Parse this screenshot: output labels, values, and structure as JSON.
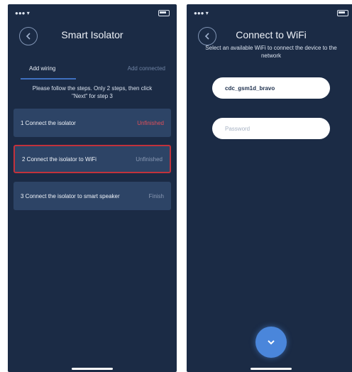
{
  "left_screen": {
    "title": "Smart Isolator",
    "tabs": [
      {
        "label": "Add wiring"
      },
      {
        "label": "Add connected"
      }
    ],
    "instruction": "Please follow the steps. Only 2 steps, then click \"Next\" for step 3",
    "steps": [
      {
        "label": "1 Connect the isolator",
        "status": "Unfinished"
      },
      {
        "label": "2 Connect the isolator to WiFi",
        "status": "Unfinished"
      },
      {
        "label": "3 Connect the isolator to smart speaker",
        "status": "Finish"
      }
    ]
  },
  "right_screen": {
    "title": "Connect to WiFi",
    "subtitle": "Select an available WiFi to connect the device to the network",
    "wifi_name": "cdc_gsm1d_bravo",
    "password_placeholder": "Password"
  },
  "colors": {
    "background": "#1b2b45",
    "card": "#2d4466",
    "highlight": "#c2323c",
    "accent": "#4a86db"
  }
}
